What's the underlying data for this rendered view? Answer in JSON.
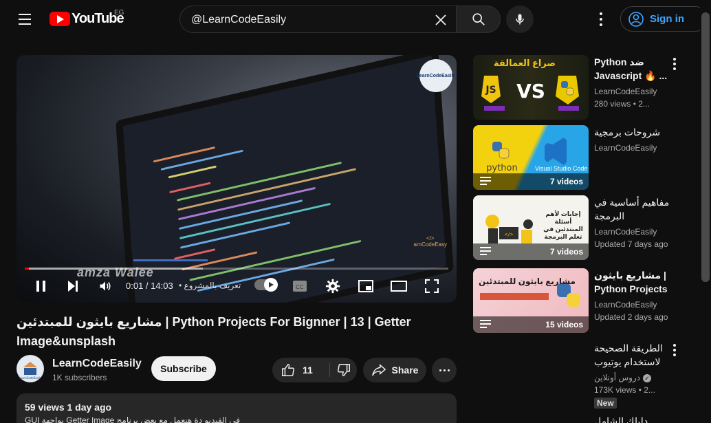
{
  "header": {
    "logo_text": "YouTube",
    "region": "EG",
    "search_value": "@LearnCodeEasily",
    "signin_label": "Sign in"
  },
  "player": {
    "watermark": "amza Walee",
    "channel_badge": "LearnCodeEasily",
    "time": "0:01 / 14:03",
    "chapter": "• تعريف بالمشروع",
    "progress_played_fraction": 0.002,
    "progress_loaded_fraction": 0.42
  },
  "video": {
    "title": "مشاريع بايثون للمبتدئين | Python Projects For Bignner | 13 | Getter Image&unsplash",
    "channel_name": "LearnCodeEasily",
    "subscribers": "1K subscribers",
    "subscribe_label": "Subscribe",
    "likes": "11",
    "share_label": "Share",
    "views_date": "59 views  1 day ago",
    "description_preview": "في الفيديو دة هنعمل مع بعض برنامج Getter Image بواجهة GUI"
  },
  "recommendations": [
    {
      "title": "Python ضد Javascript 🔥 ...",
      "channel": "LearnCodeEasily",
      "meta": "280 views • 2...",
      "overlay": "",
      "thumb_text": "صراع العمالقة"
    },
    {
      "title": "شروحات برمجية",
      "channel": "LearnCodeEasily",
      "meta": "",
      "overlay": "7 videos",
      "thumb_text": "Visual Studio Code"
    },
    {
      "title": "مفاهيم أساسية في البرمجة",
      "channel": "LearnCodeEasily",
      "meta": "Updated 7 days ago",
      "overlay": "7 videos",
      "thumb_text": "إجابات لأهم أسئلة المبتدئين في تعلم البرمجة"
    },
    {
      "title": "مشاريع بايثون | Python Projects",
      "channel": "LearnCodeEasily",
      "meta": "Updated 2 days ago",
      "overlay": "15 videos",
      "thumb_text": "مشاريع بايثون للمبتدئين"
    },
    {
      "title": "الطريقة الصحيحة لاستخدام يوتيوب",
      "channel": "دروس أونلاين",
      "meta": "173K views • 2...",
      "badge": "New"
    },
    {
      "title": "دليلك الشامل للتعرف",
      "channel": "",
      "meta": ""
    }
  ],
  "icons": {
    "menu": "menu-icon",
    "search": "search-icon",
    "mic": "microphone-icon",
    "more": "more-vert-icon",
    "account": "account-circle-icon"
  },
  "colors": {
    "background": "#0f0f0f",
    "accent_red": "#ff0000",
    "link_blue": "#3ea6ff"
  }
}
